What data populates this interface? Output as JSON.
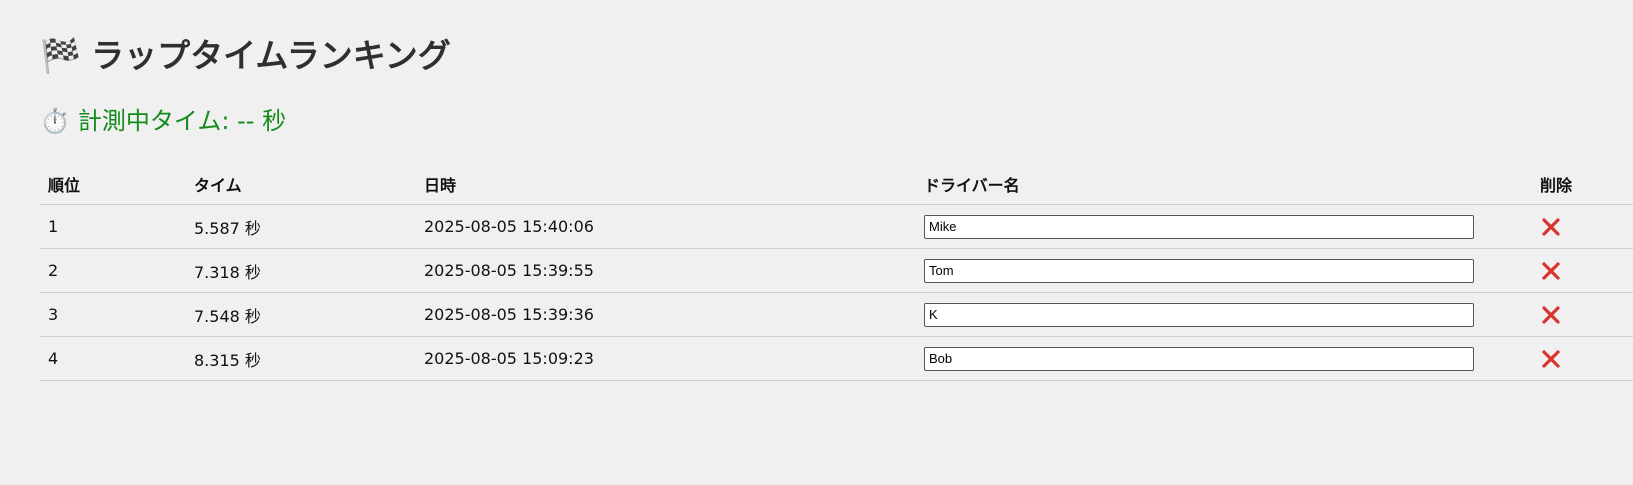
{
  "header": {
    "title_icon": "🏁",
    "title": "ラップタイムランキング",
    "timer_icon": "⏱️",
    "timer_text": "計測中タイム: -- 秒"
  },
  "table": {
    "columns": [
      "順位",
      "タイム",
      "日時",
      "ドライバー名",
      "削除"
    ],
    "rows": [
      {
        "rank": "1",
        "time": "5.587 秒",
        "datetime": "2025-08-05 15:40:06",
        "driver": "Mike"
      },
      {
        "rank": "2",
        "time": "7.318 秒",
        "datetime": "2025-08-05 15:39:55",
        "driver": "Tom"
      },
      {
        "rank": "3",
        "time": "7.548 秒",
        "datetime": "2025-08-05 15:39:36",
        "driver": "K"
      },
      {
        "rank": "4",
        "time": "8.315 秒",
        "datetime": "2025-08-05 15:09:23",
        "driver": "Bob"
      }
    ],
    "delete_icon": "close-icon",
    "delete_color": "#d9342b"
  }
}
